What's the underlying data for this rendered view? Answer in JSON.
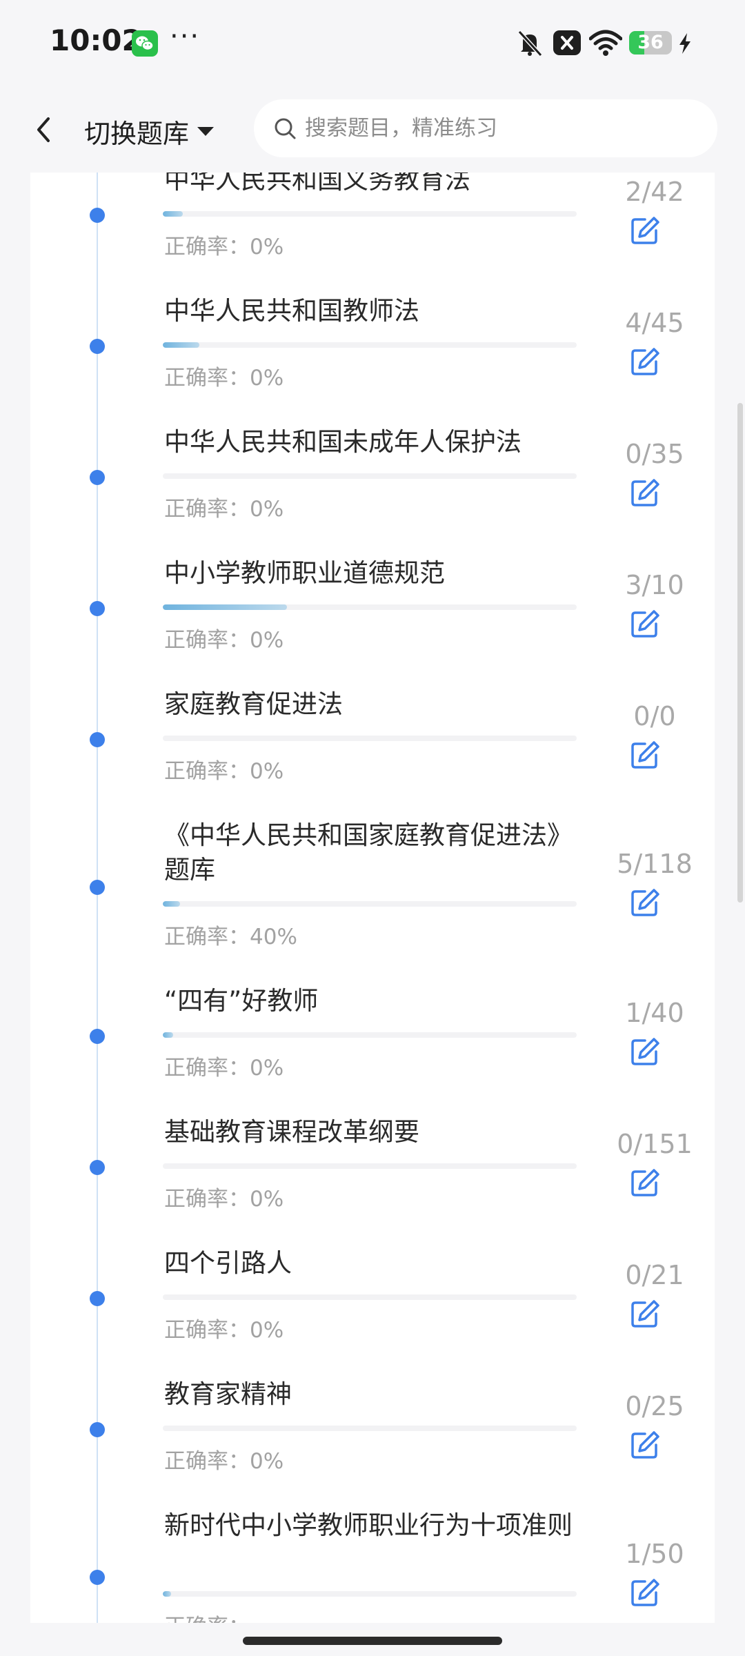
{
  "status_bar": {
    "time": "10:02",
    "more": "···",
    "battery": "36",
    "battery_level": 0.36,
    "icons": [
      "wechat-icon",
      "bell-off-icon",
      "close-box-icon",
      "wifi-icon",
      "charging-bolt-icon"
    ]
  },
  "header": {
    "back_icon": "chevron-left-icon",
    "switch_label": "切换题库",
    "search_placeholder": "搜索题目，精准练习"
  },
  "colors": {
    "accent": "#3d80ea",
    "progress": "#6fb3de",
    "muted_text": "#a2a2a2"
  },
  "items": [
    {
      "title": "中华人民共和国义务教育法",
      "progress": 0.048,
      "rate_label": "正确率：",
      "rate_value": "0%",
      "count": "2/42",
      "icon": "edit-icon"
    },
    {
      "title": "中华人民共和国教师法",
      "progress": 0.089,
      "rate_label": "正确率：",
      "rate_value": "0%",
      "count": "4/45",
      "icon": "edit-icon"
    },
    {
      "title": "中华人民共和国未成年人保护法",
      "progress": 0,
      "rate_label": "正确率：",
      "rate_value": "0%",
      "count": "0/35",
      "icon": "edit-icon"
    },
    {
      "title": "中小学教师职业道德规范",
      "progress": 0.3,
      "rate_label": "正确率：",
      "rate_value": "0%",
      "count": "3/10",
      "icon": "edit-icon"
    },
    {
      "title": "家庭教育促进法",
      "progress": 0,
      "rate_label": "正确率：",
      "rate_value": "0%",
      "count": "0/0",
      "icon": "edit-icon"
    },
    {
      "title": "《中华人民共和国家庭教育促进法》题库",
      "progress": 0.042,
      "rate_label": "正确率：",
      "rate_value": "40%",
      "count": "5/118",
      "icon": "edit-icon"
    },
    {
      "title": "“四有”好教师",
      "progress": 0.025,
      "rate_label": "正确率：",
      "rate_value": "0%",
      "count": "1/40",
      "icon": "edit-icon"
    },
    {
      "title": "基础教育课程改革纲要",
      "progress": 0,
      "rate_label": "正确率：",
      "rate_value": "0%",
      "count": "0/151",
      "icon": "edit-icon"
    },
    {
      "title": "四个引路人",
      "progress": 0,
      "rate_label": "正确率：",
      "rate_value": "0%",
      "count": "0/21",
      "icon": "edit-icon"
    },
    {
      "title": "教育家精神",
      "progress": 0,
      "rate_label": "正确率：",
      "rate_value": "0%",
      "count": "0/25",
      "icon": "edit-icon"
    },
    {
      "title": "新时代中小学教师职业行为十项准则",
      "progress": 0.02,
      "rate_label": "正确率：",
      "rate_value": "",
      "count": "1/50",
      "icon": "edit-icon"
    }
  ]
}
